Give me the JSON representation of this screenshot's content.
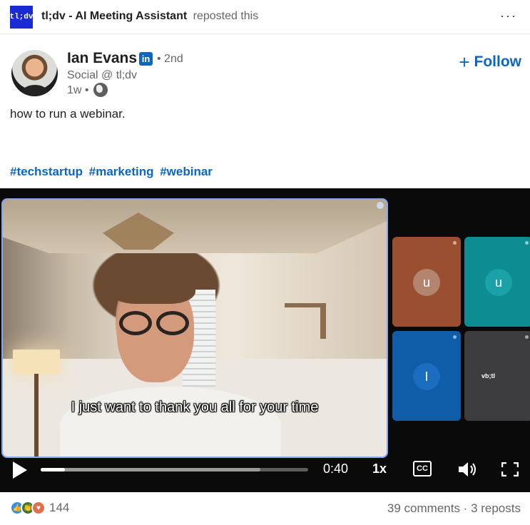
{
  "repost": {
    "logo_text": "tl;dv",
    "name": "tl;dv - AI Meeting Assistant",
    "suffix": "reposted this",
    "more_label": "···"
  },
  "author": {
    "name": "Ian Evans",
    "linkedin_badge": "in",
    "degree": "• 2nd",
    "headline": "Social @ tl;dv",
    "time": "1w •"
  },
  "follow": {
    "plus": "+",
    "label": "Follow"
  },
  "post": {
    "text": "how to run a webinar.",
    "hashtags": [
      "#techstartup",
      "#marketing",
      "#webinar"
    ]
  },
  "video": {
    "caption": "I just want to thank you all for your time",
    "participants": [
      {
        "initial": "u",
        "color": "#9a4f30"
      },
      {
        "initial": "u",
        "color": "#0d8c92"
      },
      {
        "initial": "I",
        "color": "#0f5ca9"
      },
      {
        "brand": "vb;tl",
        "color": "#3c3c3e"
      }
    ],
    "controls": {
      "time": "0:40",
      "speed": "1x",
      "cc": "CC",
      "progress_fraction": 0.09,
      "buffer_fraction": 0.82
    }
  },
  "footer": {
    "reaction_count": "144",
    "comments": "39 comments",
    "separator": " · ",
    "reposts": "3 reposts"
  },
  "colors": {
    "link_blue": "#0a66c2",
    "video_bg": "#0a0a0b"
  }
}
